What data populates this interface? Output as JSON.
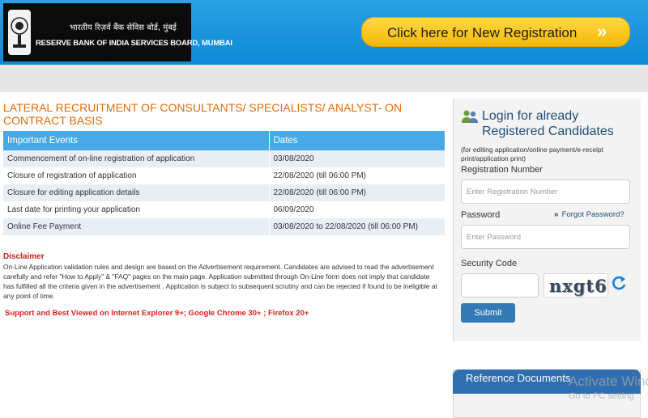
{
  "header": {
    "logo_hindi": "भारतीय रिज़र्व बैंक सेविस बोर्ड, मुंबई",
    "logo_english": "RESERVE BANK OF INDIA SERVICES BOARD, MUMBAI",
    "new_registration_label": "Click here for New Registration",
    "new_registration_arrow": "»"
  },
  "main": {
    "title": "LATERAL RECRUITMENT OF CONSULTANTS/ SPECIALISTS/ ANALYST- ON CONTRACT BASIS",
    "table": {
      "headers": [
        "Important Events",
        "Dates"
      ],
      "rows": [
        [
          "Commencement of on-line registration of application",
          "03/08/2020"
        ],
        [
          "Closure of registration of application",
          "22/08/2020 (till 06:00 PM)"
        ],
        [
          "Closure for editing application details",
          "22/08/2020 (till 06:00 PM)"
        ],
        [
          "Last date for printing your application",
          "06/09/2020"
        ],
        [
          "Online Fee Payment",
          "03/08/2020 to 22/08/2020 (till 06:00 PM)"
        ]
      ]
    },
    "disclaimer_heading": "Disclaimer",
    "disclaimer_text": "On-Line Application validation rules and design are based on the Advertisement requirement. Candidates are advised to read the advertisement carefully and refer \"How to Apply\" & \"FAQ\" pages on the main page. Application submitted through On-Line form does not imply that candidate has fulfilled all the criteria given in the advertisement . Application is subject to subsequent scrutiny and can be rejected if found to be ineligible at any point of time.",
    "support_text": "Support and Best Viewed on Internet Explorer 9+; Google Chrome 30+ ; Firefox 20+"
  },
  "login": {
    "heading_line1": "Login for already",
    "heading_line2": "Registered Candidates",
    "note": "(for editing application/online payment/e-receipt print/application print)",
    "reg_label": "Registration Number",
    "reg_placeholder": "Enter Registration Number",
    "password_label": "Password",
    "forgot_label": "Forgot Password?",
    "forgot_icon": "»",
    "password_placeholder": "Enter Password",
    "security_label": "Security Code",
    "captcha_text": "nxgt6",
    "submit_label": "Submit"
  },
  "reference": {
    "title": "Reference Documents"
  },
  "watermark": {
    "line1": "Activate Wind",
    "line2": "Go to PC setting"
  }
}
